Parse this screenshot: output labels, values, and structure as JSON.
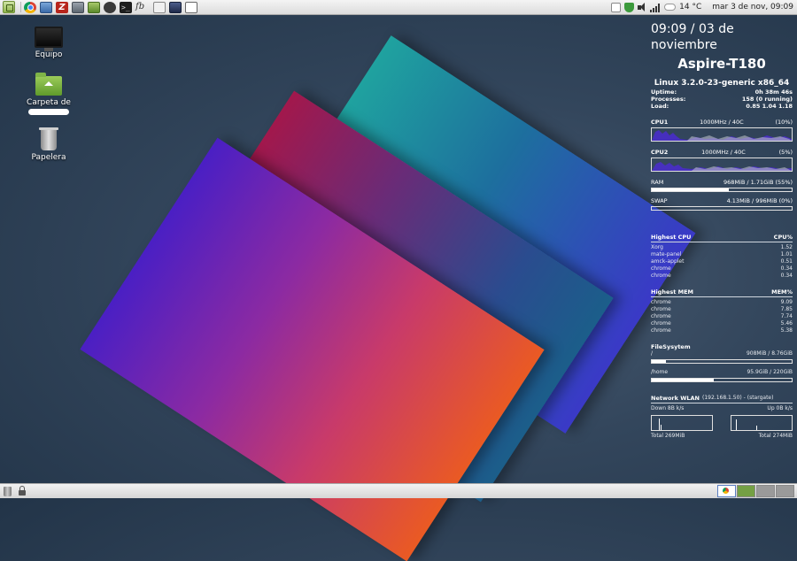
{
  "top_panel": {
    "launchers": [
      "chrome-icon",
      "file-manager-icon",
      "filezilla-icon",
      "system-monitor-icon",
      "software-center-icon",
      "disk-icon",
      "terminal-icon",
      "fb-reader-icon",
      "text-editor-icon",
      "computer-icon",
      "screen-icon"
    ],
    "filezilla_glyph": "Z",
    "terminal_glyph": ">_",
    "fb_glyph": "fb",
    "weather": "14 °C",
    "clock": "mar  3 de nov, 09:09"
  },
  "desktop_icons": [
    {
      "name": "equipo",
      "label": "Equipo"
    },
    {
      "name": "home-folder",
      "label": "Carpeta de"
    },
    {
      "name": "trash",
      "label": "Papelera"
    }
  ],
  "conky": {
    "time": "09:09 / 03 de noviembre",
    "hostname": "Aspire-T180",
    "kernel": "Linux 3.2.0-23-generic x86_64",
    "uptime_label": "Uptime:",
    "uptime": "0h 38m 46s",
    "processes_label": "Processes:",
    "processes": "158 (0 running)",
    "load_label": "Load:",
    "load": "0.85 1.04 1.18",
    "cpu1": {
      "label": "CPU1",
      "freq": "1000MHz / 40C",
      "usage": "(10%)"
    },
    "cpu2": {
      "label": "CPU2",
      "freq": "1000MHz / 40C",
      "usage": "(5%)"
    },
    "ram": {
      "label": "RAM",
      "value": "968MiB / 1.71GiB (55%)",
      "fraction": 0.55
    },
    "swap": {
      "label": "SWAP",
      "value": "4.13MiB / 996MiB (0%)",
      "fraction": 0.0
    },
    "highest_cpu": {
      "title": "Highest CPU",
      "col": "CPU%",
      "rows": [
        {
          "name": "Xorg",
          "value": "1.52"
        },
        {
          "name": "mate-panel",
          "value": "1.01"
        },
        {
          "name": "amck-applet",
          "value": "0.51"
        },
        {
          "name": "chrome",
          "value": "0.34"
        },
        {
          "name": "chrome",
          "value": "0.34"
        }
      ]
    },
    "highest_mem": {
      "title": "Highest MEM",
      "col": "MEM%",
      "rows": [
        {
          "name": "chrome",
          "value": "9.09"
        },
        {
          "name": "chrome",
          "value": "7.85"
        },
        {
          "name": "chrome",
          "value": "7.74"
        },
        {
          "name": "chrome",
          "value": "5.46"
        },
        {
          "name": "chrome",
          "value": "5.38"
        }
      ]
    },
    "filesystem": {
      "title": "FileSysytem",
      "root": {
        "label": "/",
        "value": "908MiB / 8.76GiB",
        "fraction": 0.1
      },
      "home": {
        "label": "/home",
        "value": "95.9GiB / 220GiB",
        "fraction": 0.44
      }
    },
    "network": {
      "title": "Network WLAN",
      "subtitle": "(192.168.1.50) - (stargate)",
      "down": "Down 8B k/s",
      "up": "Up 0B k/s",
      "total_down": "Total 269MiB",
      "total_up": "Total 274MiB"
    }
  },
  "bottom_panel": {
    "workspaces": 4,
    "active_workspace": 1
  }
}
